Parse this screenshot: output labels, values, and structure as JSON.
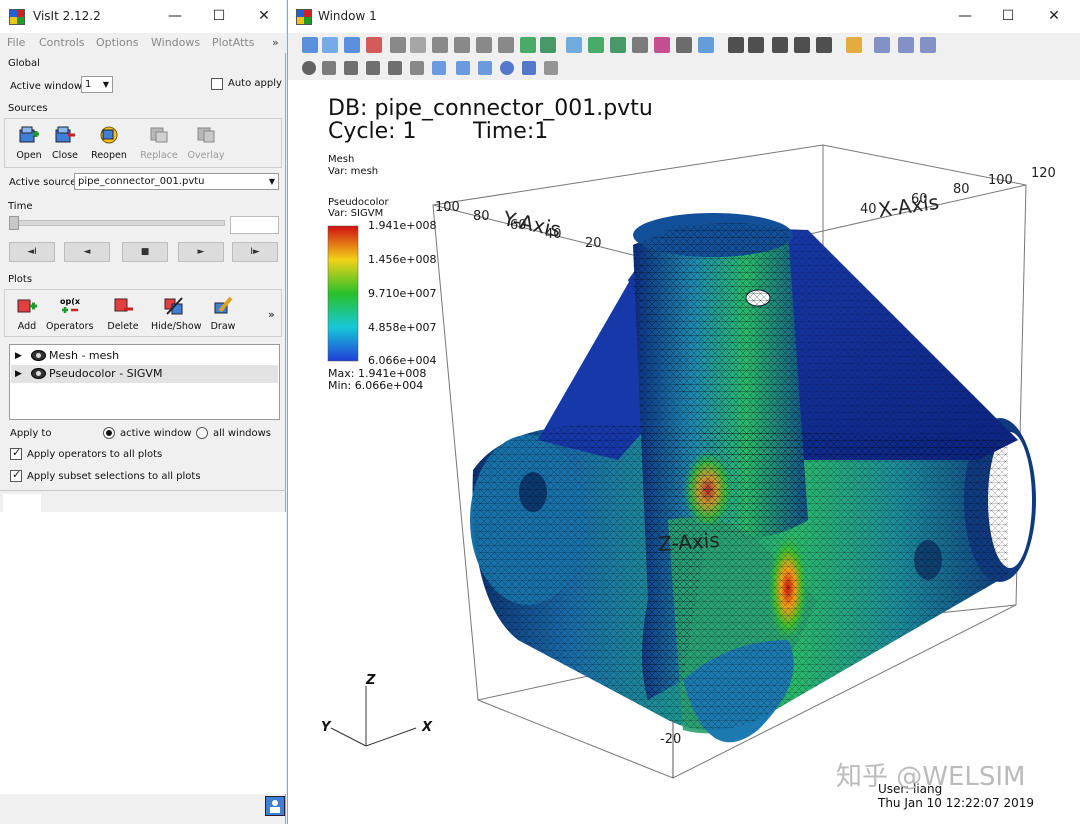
{
  "left_window": {
    "title": "VisIt 2.12.2",
    "menu": [
      "File",
      "Controls",
      "Options",
      "Windows",
      "PlotAtts"
    ],
    "menu_overflow": "»",
    "global": {
      "title": "Global",
      "active_window_label": "Active window",
      "active_window_value": "1",
      "auto_apply_label": "Auto apply",
      "auto_apply_checked": false
    },
    "sources": {
      "title": "Sources",
      "buttons": [
        {
          "label": "Open",
          "icon": "open-icon",
          "enabled": true
        },
        {
          "label": "Close",
          "icon": "close-db-icon",
          "enabled": true
        },
        {
          "label": "Reopen",
          "icon": "reopen-icon",
          "enabled": true
        },
        {
          "label": "Replace",
          "icon": "replace-icon",
          "enabled": false
        },
        {
          "label": "Overlay",
          "icon": "overlay-icon",
          "enabled": false
        }
      ],
      "active_source_label": "Active source",
      "active_source_value": "pipe_connector_001.pvtu"
    },
    "time": {
      "title": "Time",
      "buttons": [
        "◄I",
        "◄",
        "■",
        "►",
        "I►"
      ]
    },
    "plots": {
      "title": "Plots",
      "buttons": [
        {
          "label": "Add",
          "icon": "add-plot-icon"
        },
        {
          "label": "Operators",
          "icon": "operators-icon"
        },
        {
          "label": "Delete",
          "icon": "delete-plot-icon"
        },
        {
          "label": "Hide/Show",
          "icon": "hide-show-icon"
        },
        {
          "label": "Draw",
          "icon": "draw-icon"
        }
      ],
      "overflow": "»",
      "list": [
        {
          "label": "Mesh - mesh",
          "selected": false
        },
        {
          "label": "Pseudocolor - SIGVM",
          "selected": true
        }
      ],
      "apply_to_label": "Apply to",
      "apply_options": [
        "active window",
        "all windows"
      ],
      "apply_selected": "active window",
      "apply_operators_label": "Apply operators to all plots",
      "apply_subset_label": "Apply subset selections to all plots"
    }
  },
  "right_window": {
    "title": "Window 1",
    "canvas": {
      "db_line": "DB: pipe_connector_001.pvtu",
      "cycle_line": "Cycle: 1",
      "time_line": "Time:1",
      "legend_mesh": {
        "plot": "Mesh",
        "var": "Var: mesh"
      },
      "legend_pseudo": {
        "plot": "Pseudocolor",
        "var": "Var: SIGVM",
        "ticks": [
          "1.941e+008",
          "1.456e+008",
          "9.710e+007",
          "4.858e+007",
          "6.066e+004"
        ],
        "max": "Max:  1.941e+008",
        "min": "Min:  6.066e+004"
      },
      "axes": {
        "x_label": "X-Axis",
        "y_label": "Y-Axis",
        "z_label": "Z-Axis",
        "x_ticks": [
          "40",
          "60",
          "80",
          "100"
        ],
        "x_tick_120": "120",
        "y_ticks": [
          "100",
          "80",
          "60",
          "40",
          "20"
        ],
        "z_tick": "-20",
        "triad": {
          "z": "Z",
          "y": "Y",
          "x": "X"
        }
      },
      "user_line": "User: liang",
      "date_line": "Thu Jan 10 12:22:07 2019",
      "watermark": "知乎 @WELSIM"
    }
  },
  "colors": {
    "colorbar": [
      "#d01010",
      "#f2d21a",
      "#28c028",
      "#18c8d8",
      "#1f3fd8"
    ]
  }
}
